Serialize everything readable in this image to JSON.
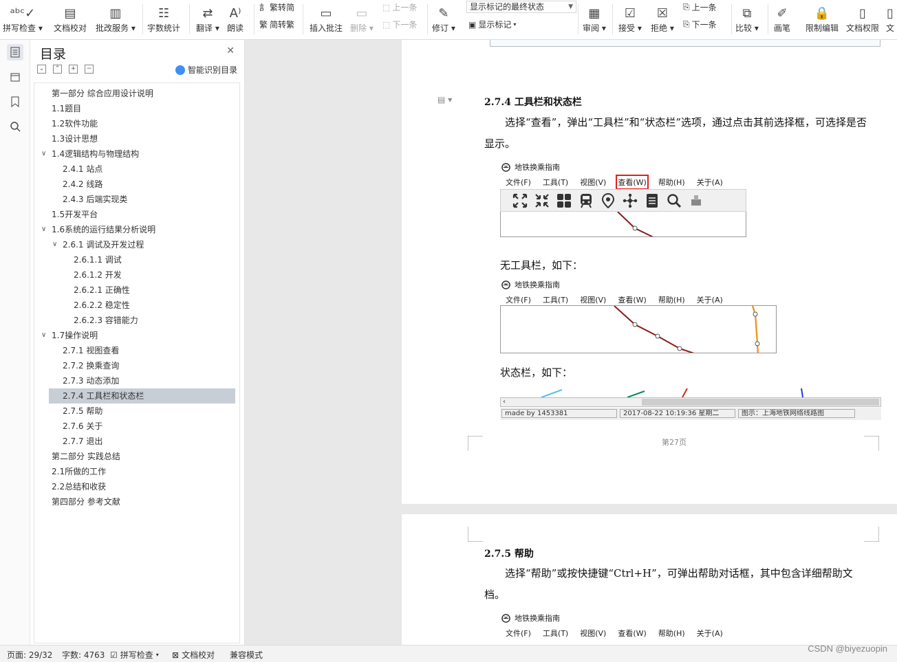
{
  "ribbon": {
    "buttons": [
      {
        "label": "拼写检查",
        "dropdown": true,
        "icon": "abc-spellcheck-icon"
      },
      {
        "label": "文档校对",
        "dropdown": false,
        "icon": "document-proof-icon"
      },
      {
        "label": "批改服务",
        "dropdown": true,
        "icon": "correction-service-icon"
      },
      {
        "label": "字数统计",
        "dropdown": false,
        "icon": "word-count-icon"
      },
      {
        "label": "翻译",
        "dropdown": true,
        "icon": "translate-icon"
      },
      {
        "label": "朗读",
        "dropdown": false,
        "icon": "read-aloud-icon"
      },
      {
        "label": "插入批注",
        "dropdown": false,
        "icon": "insert-comment-icon"
      },
      {
        "label": "删除",
        "dropdown": true,
        "icon": "delete-comment-icon"
      },
      {
        "label": "修订",
        "dropdown": true,
        "icon": "track-changes-icon"
      },
      {
        "label": "审阅",
        "dropdown": true,
        "icon": "review-icon"
      },
      {
        "label": "接受",
        "dropdown": true,
        "icon": "accept-icon"
      },
      {
        "label": "拒绝",
        "dropdown": true,
        "icon": "reject-icon"
      },
      {
        "label": "比较",
        "dropdown": true,
        "icon": "compare-icon"
      },
      {
        "label": "画笔",
        "dropdown": false,
        "icon": "pen-icon"
      },
      {
        "label": "限制编辑",
        "dropdown": false,
        "icon": "restrict-edit-icon"
      },
      {
        "label": "文档权限",
        "dropdown": false,
        "icon": "doc-permission-icon"
      },
      {
        "label": "文",
        "dropdown": false,
        "icon": "doc-icon"
      }
    ],
    "trad_to_simp": "繁转简",
    "simp_to_trad": "简转繁",
    "prev_comment": "上一条",
    "next_comment": "下一条",
    "markup_select": "显示标记的最终状态",
    "show_markup": "显示标记",
    "prev_change": "上一条",
    "next_change": "下一条"
  },
  "toc": {
    "title": "目录",
    "smart_label": "智能识别目录",
    "items": [
      {
        "text": "第一部分  综合应用设计说明",
        "level": 0,
        "chev": ""
      },
      {
        "text": "1.1题目",
        "level": 0,
        "chev": ""
      },
      {
        "text": "1.2软件功能",
        "level": 0,
        "chev": ""
      },
      {
        "text": "1.3设计思想",
        "level": 0,
        "chev": ""
      },
      {
        "text": "1.4逻辑结构与物理结构",
        "level": 0,
        "chev": "v"
      },
      {
        "text": "2.4.1  站点",
        "level": 1,
        "chev": ""
      },
      {
        "text": "2.4.2  线路",
        "level": 1,
        "chev": ""
      },
      {
        "text": "2.4.3  后端实现类",
        "level": 1,
        "chev": ""
      },
      {
        "text": "1.5开发平台",
        "level": 0,
        "chev": ""
      },
      {
        "text": "1.6系统的运行结果分析说明",
        "level": 0,
        "chev": "v"
      },
      {
        "text": "2.6.1  调试及开发过程",
        "level": 1,
        "chev": "v"
      },
      {
        "text": "2.6.1.1  调试",
        "level": 2,
        "chev": ""
      },
      {
        "text": "2.6.1.2  开发",
        "level": 2,
        "chev": ""
      },
      {
        "text": "2.6.2.1  正确性",
        "level": 2,
        "chev": ""
      },
      {
        "text": "2.6.2.2  稳定性",
        "level": 2,
        "chev": ""
      },
      {
        "text": "2.6.2.3  容错能力",
        "level": 2,
        "chev": ""
      },
      {
        "text": "1.7操作说明",
        "level": 0,
        "chev": "v"
      },
      {
        "text": "2.7.1  视图查看",
        "level": 1,
        "chev": ""
      },
      {
        "text": "2.7.2  换乘查询",
        "level": 1,
        "chev": ""
      },
      {
        "text": "2.7.3  动态添加",
        "level": 1,
        "chev": ""
      },
      {
        "text": "2.7.4  工具栏和状态栏",
        "level": 1,
        "chev": "",
        "selected": true
      },
      {
        "text": "2.7.5  帮助",
        "level": 1,
        "chev": ""
      },
      {
        "text": "2.7.6  关于",
        "level": 1,
        "chev": ""
      },
      {
        "text": "2.7.7  退出",
        "level": 1,
        "chev": ""
      },
      {
        "text": "第二部分  实践总结",
        "level": 0,
        "chev": ""
      },
      {
        "text": "2.1所做的工作",
        "level": 0,
        "chev": ""
      },
      {
        "text": "2.2总结和收获",
        "level": 0,
        "chev": ""
      },
      {
        "text": "第四部分  参考文献",
        "level": 0,
        "chev": ""
      }
    ]
  },
  "doc": {
    "h274": "2.7.4  工具栏和状态栏",
    "p274": "选择“查看”，弹出“工具栏”和“状态栏”选项，通过点击其前选择框，可选择是否显示。",
    "app_title": "地铁换乘指南",
    "app_menu": [
      "文件(F)",
      "工具(T)",
      "视图(V)",
      "查看(W)",
      "帮助(H)",
      "关于(A)"
    ],
    "no_toolbar": "无工具栏，如下：",
    "status_caption": "状态栏，如下：",
    "status_fields": [
      "made by 1453381",
      "2017-08-22 10:19:36 星期二",
      "图示：上海地铁网络线路图"
    ],
    "page_num": "第27页",
    "h275": "2.7.5  帮助",
    "p275": "选择“帮助”或按快捷键“Ctrl+H”，可弹出帮助对话框，其中包含详细帮助文档。"
  },
  "status": {
    "page": "页面: 29/32",
    "words": "字数: 4763",
    "spell": "拼写检查",
    "proof": "文档校对",
    "compat": "兼容模式"
  },
  "watermark": "CSDN @biyezuopin",
  "colors": {
    "accent": "#3d8ff6",
    "highlight_box": "#e02020",
    "selected_toc": "#c8ced6"
  }
}
